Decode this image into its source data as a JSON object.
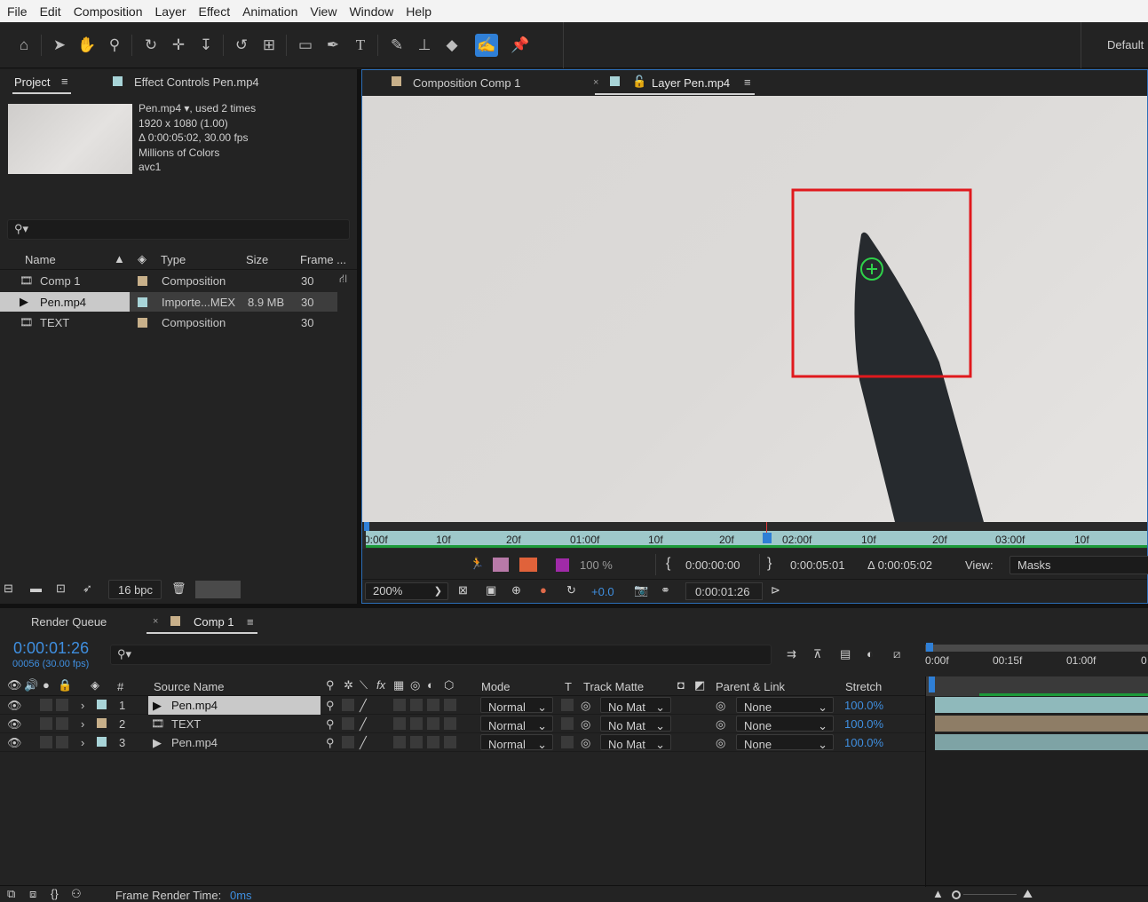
{
  "menu": [
    "File",
    "Edit",
    "Composition",
    "Layer",
    "Effect",
    "Animation",
    "View",
    "Window",
    "Help"
  ],
  "toolbar": {
    "tools": [
      "home-icon",
      "selection-icon",
      "hand-icon",
      "zoom-icon",
      "orbit-camera-icon",
      "pan-camera-icon",
      "dolly-camera-icon",
      "rotate-icon",
      "pan-behind-icon",
      "rectangle-icon",
      "pen-icon",
      "type-icon",
      "brush-icon",
      "clone-stamp-icon",
      "eraser-icon",
      "roto-brush-icon",
      "puppet-pin-icon"
    ],
    "workspace": "Default"
  },
  "project": {
    "tab_label": "Project",
    "effect_controls_label": "Effect Controls Pen.mp4",
    "info": {
      "name": "Pen.mp4",
      "used": ", used 2 times",
      "dimensions": "1920 x 1080 (1.00)",
      "duration": "Δ 0:00:05:02, 30.00 fps",
      "colors": "Millions of Colors",
      "codec": "avc1"
    },
    "search_placeholder": "",
    "columns": {
      "name": "Name",
      "type": "Type",
      "size": "Size",
      "frame": "Frame ..."
    },
    "items": [
      {
        "name": "Comp 1",
        "type": "Composition",
        "size": "",
        "frame": "30",
        "color": "#c8b08a"
      },
      {
        "name": "Pen.mp4",
        "type": "Importe...MEX",
        "size": "8.9 MB",
        "frame": "30",
        "color": "#a8d4d8"
      },
      {
        "name": "TEXT",
        "type": "Composition",
        "size": "",
        "frame": "30",
        "color": "#c8b08a"
      }
    ],
    "bpc": "16 bpc"
  },
  "viewer": {
    "comp_tab": "Composition Comp 1",
    "layer_tab": "Layer Pen.mp4",
    "ruler_ticks": [
      "0:00f",
      "10f",
      "20f",
      "01:00f",
      "10f",
      "20f",
      "02:00f",
      "10f",
      "20f",
      "03:00f",
      "10f"
    ],
    "opacity": "100 %",
    "in_point": "0:00:00:00",
    "out_point": "0:00:05:01",
    "duration": "Δ 0:00:05:02",
    "view_label": "View:",
    "view_value": "Masks",
    "zoom": "200%",
    "exposure": "+0.0",
    "current_time": "0:00:01:26"
  },
  "timeline": {
    "render_queue_label": "Render Queue",
    "comp_tab": "Comp 1",
    "timecode": "0:00:01:26",
    "frame_info": "00056 (30.00 fps)",
    "time_ticks": [
      "0:00f",
      "00:15f",
      "01:00f",
      "0"
    ],
    "columns": {
      "num": "#",
      "source": "Source Name",
      "mode": "Mode",
      "t": "T",
      "track_matte": "Track Matte",
      "parent": "Parent & Link",
      "stretch": "Stretch"
    },
    "layers": [
      {
        "num": "1",
        "name": "Pen.mp4",
        "mode": "Normal",
        "matte": "No Mat",
        "parent": "None",
        "stretch": "100.0%",
        "color": "#a8d4d8"
      },
      {
        "num": "2",
        "name": "TEXT",
        "mode": "Normal",
        "matte": "No Mat",
        "parent": "None",
        "stretch": "100.0%",
        "color": "#c8b08a"
      },
      {
        "num": "3",
        "name": "Pen.mp4",
        "mode": "Normal",
        "matte": "No Mat",
        "parent": "None",
        "stretch": "100.0%",
        "color": "#a8d4d8"
      }
    ],
    "render_time_label": "Frame Render Time:",
    "render_time_value": "0ms"
  }
}
